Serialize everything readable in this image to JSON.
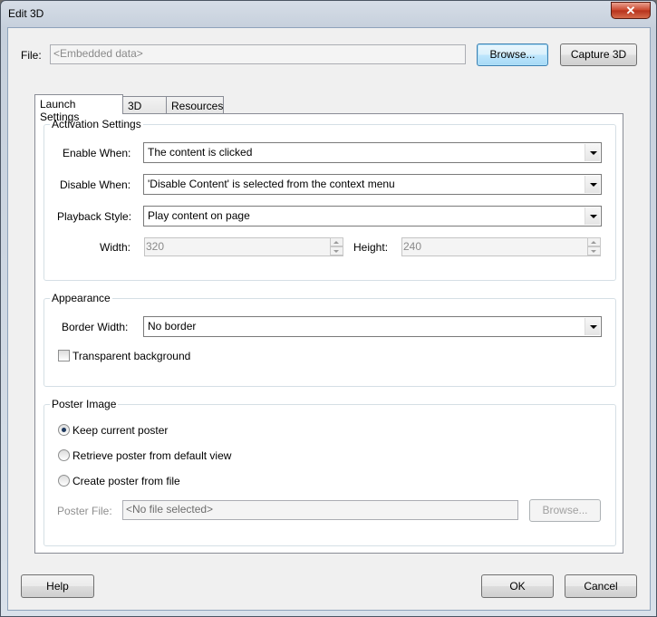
{
  "window": {
    "title": "Edit 3D",
    "close_glyph": "✕"
  },
  "file": {
    "label": "File:",
    "value": "<Embedded data>",
    "browse": "Browse...",
    "capture": "Capture 3D"
  },
  "tabs": [
    {
      "label": "Launch Settings",
      "active": true
    },
    {
      "label": "3D",
      "active": false
    },
    {
      "label": "Resources",
      "active": false
    }
  ],
  "activation": {
    "title": "Activation Settings",
    "enable_label": "Enable When:",
    "enable_value": "The content is clicked",
    "disable_label": "Disable When:",
    "disable_value": "'Disable Content' is selected from the context menu",
    "playback_label": "Playback Style:",
    "playback_value": "Play content on page",
    "width_label": "Width:",
    "width_value": "320",
    "height_label": "Height:",
    "height_value": "240"
  },
  "appearance": {
    "title": "Appearance",
    "border_label": "Border Width:",
    "border_value": "No border",
    "transparent_label": "Transparent background",
    "transparent_checked": false
  },
  "poster": {
    "title": "Poster Image",
    "options": [
      {
        "label": "Keep current poster",
        "checked": true
      },
      {
        "label": "Retrieve poster from default view",
        "checked": false
      },
      {
        "label": "Create poster from file",
        "checked": false
      }
    ],
    "file_label": "Poster File:",
    "file_value": "<No file selected>",
    "browse": "Browse..."
  },
  "footer": {
    "help": "Help",
    "ok": "OK",
    "cancel": "Cancel"
  }
}
